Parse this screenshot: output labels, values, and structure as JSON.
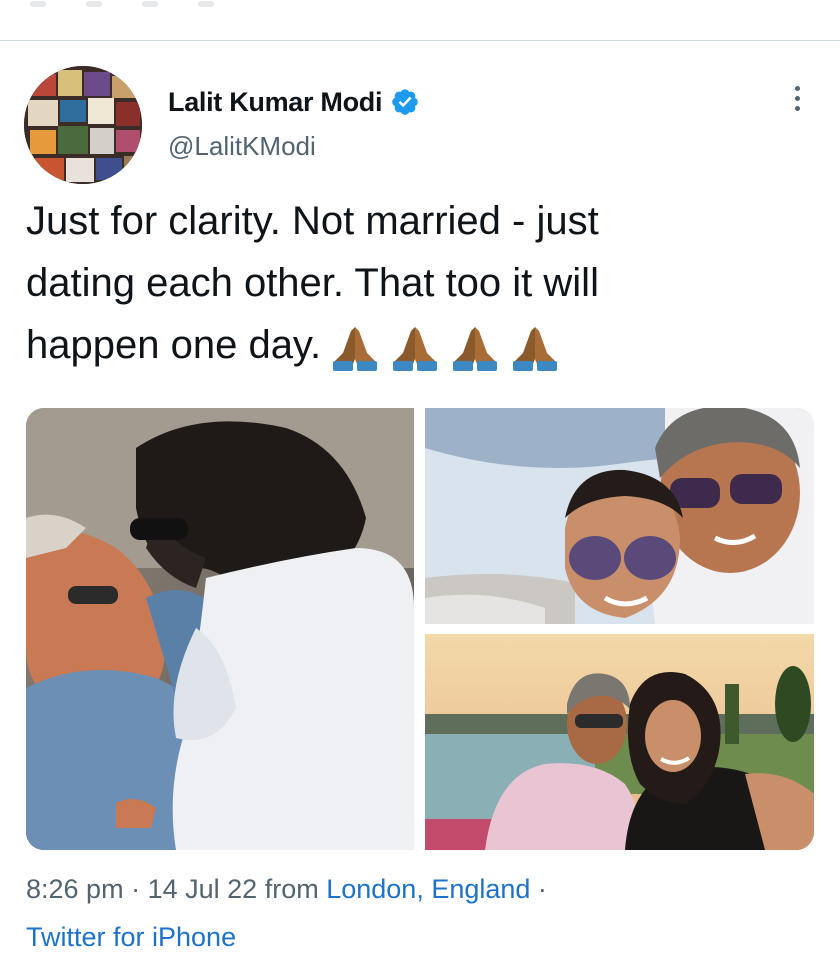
{
  "author": {
    "display_name": "Lalit Kumar Modi",
    "handle": "@LalitKModi",
    "verified": true
  },
  "tweet": {
    "text_lines": [
      "Just for clarity. Not married - just",
      "dating each other. That too it will",
      "happen one day."
    ],
    "emoji": [
      "folded-hands",
      "folded-hands",
      "folded-hands",
      "folded-hands"
    ]
  },
  "media": {
    "count": 3,
    "photos": [
      {
        "name": "photo-embrace-couch"
      },
      {
        "name": "photo-selfie-sunglasses"
      },
      {
        "name": "photo-harbor-sunset"
      }
    ]
  },
  "meta": {
    "time": "8:26 pm",
    "separator": "·",
    "date": "14 Jul 22",
    "from_word": "from",
    "location": "London, England",
    "trailing_dot": "·",
    "source": "Twitter for iPhone"
  },
  "colors": {
    "text": "#0f1419",
    "secondary": "#536471",
    "link": "#1d72c9",
    "verified": "#1d9bf0"
  }
}
